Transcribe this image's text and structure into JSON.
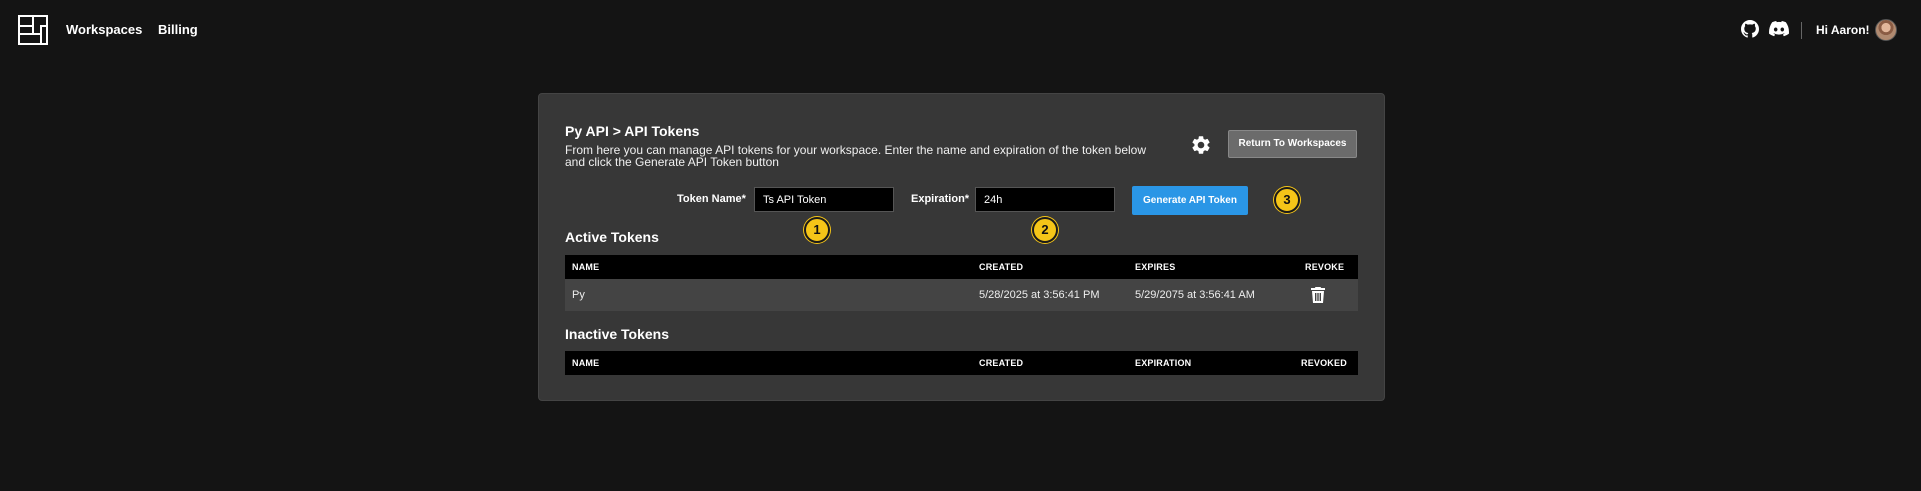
{
  "nav": {
    "links": [
      "Workspaces",
      "Billing"
    ],
    "greeting": "Hi Aaron!",
    "icons": [
      "app-logo",
      "github-icon",
      "discord-icon",
      "avatar"
    ]
  },
  "card": {
    "title": "Py API > API Tokens",
    "description": "From here you can manage API tokens for your workspace. Enter the name and expiration of the token below and click the Generate API Token button",
    "return_label": "Return To Workspaces",
    "settings_icon": "gear-icon"
  },
  "form": {
    "token_name_label": "Token Name*",
    "token_name_value": "Ts API Token",
    "expiration_label": "Expiration*",
    "expiration_value": "24h",
    "generate_label": "Generate API Token"
  },
  "markers": [
    "1",
    "2",
    "3"
  ],
  "active": {
    "title": "Active Tokens",
    "headers": [
      "NAME",
      "CREATED",
      "EXPIRES",
      "REVOKE"
    ],
    "rows": [
      {
        "name": "Py",
        "created": "5/28/2025 at 3:56:41 PM",
        "expires": "5/29/2075 at 3:56:41 AM",
        "revoke_icon": "trash-icon"
      }
    ]
  },
  "inactive": {
    "title": "Inactive Tokens",
    "headers": [
      "NAME",
      "CREATED",
      "EXPIRATION",
      "REVOKED"
    ]
  },
  "colors": {
    "background": "#141414",
    "card": "#373737",
    "primary": "#2a96e6",
    "marker": "#f5c518"
  }
}
